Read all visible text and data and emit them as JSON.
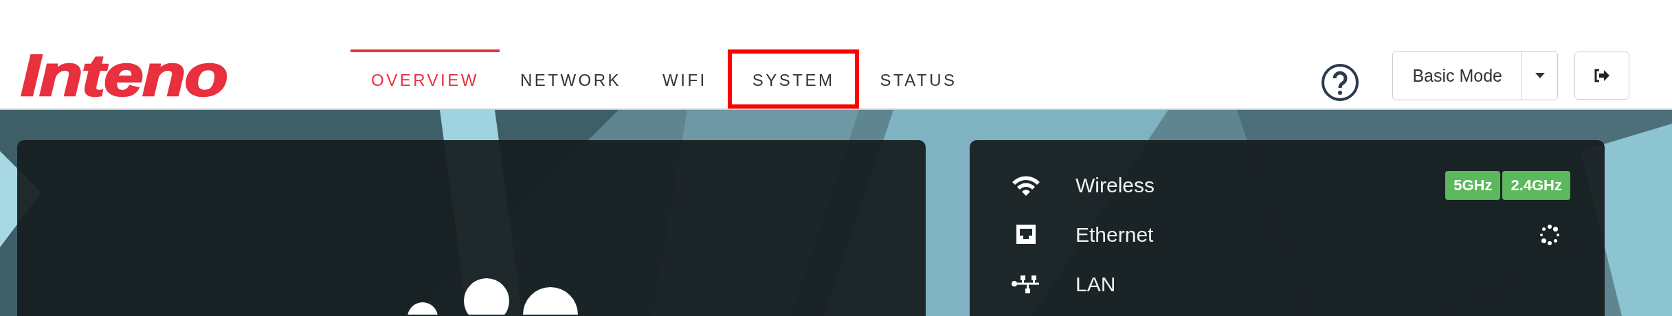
{
  "logo": {
    "text": "Inteno"
  },
  "nav": [
    {
      "label": "OVERVIEW",
      "selected": true,
      "highlighted": false
    },
    {
      "label": "NETWORK",
      "selected": false,
      "highlighted": false
    },
    {
      "label": "WIFI",
      "selected": false,
      "highlighted": false
    },
    {
      "label": "SYSTEM",
      "selected": false,
      "highlighted": true
    },
    {
      "label": "STATUS",
      "selected": false,
      "highlighted": false
    }
  ],
  "mode": {
    "label": "Basic Mode"
  },
  "interfaces": [
    {
      "kind": "wireless",
      "name": "Wireless",
      "badges": [
        "5GHz",
        "2.4GHz"
      ],
      "loading": false
    },
    {
      "kind": "ethernet",
      "name": "Ethernet",
      "loading": true
    },
    {
      "kind": "lan",
      "name": "LAN",
      "loading": false
    }
  ]
}
